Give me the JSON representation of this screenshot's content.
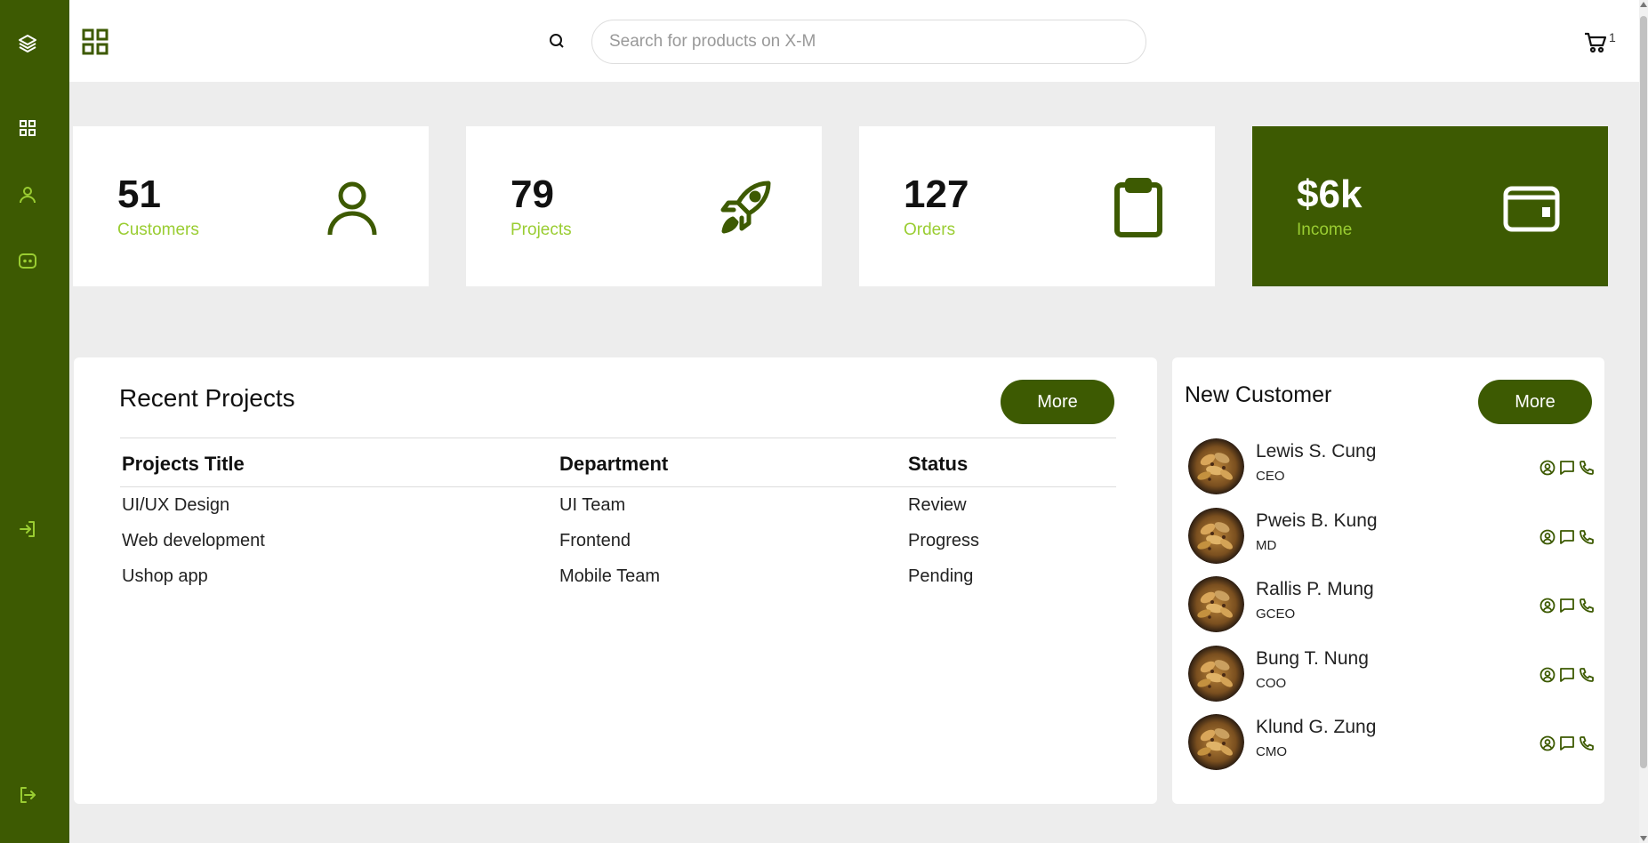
{
  "colors": {
    "brand": "#3d5a02",
    "accent": "#9acd32",
    "background": "#ededed"
  },
  "sidebar": {
    "items": [
      {
        "icon": "layers-icon"
      },
      {
        "icon": "dashboard-grid-icon"
      },
      {
        "icon": "user-icon"
      },
      {
        "icon": "chat-bot-icon"
      },
      {
        "icon": "login-icon"
      },
      {
        "icon": "logout-icon"
      }
    ]
  },
  "header": {
    "search_placeholder": "Search for products on X-M",
    "cart_count": "1"
  },
  "stats": [
    {
      "value": "51",
      "label": "Customers",
      "icon": "user-icon"
    },
    {
      "value": "79",
      "label": "Projects",
      "icon": "rocket-icon"
    },
    {
      "value": "127",
      "label": "Orders",
      "icon": "clipboard-icon"
    },
    {
      "value": "$6k",
      "label": "Income",
      "icon": "wallet-icon"
    }
  ],
  "recent_projects": {
    "title": "Recent Projects",
    "more_label": "More",
    "columns": [
      "Projects Title",
      "Department",
      "Status"
    ],
    "rows": [
      [
        "UI/UX Design",
        "UI Team",
        "Review"
      ],
      [
        "Web development",
        "Frontend",
        "Progress"
      ],
      [
        "Ushop app",
        "Mobile Team",
        "Pending"
      ]
    ]
  },
  "new_customer": {
    "title": "New Customer",
    "more_label": "More",
    "customers": [
      {
        "name": "Lewis S. Cung",
        "role": "CEO"
      },
      {
        "name": "Pweis B. Kung",
        "role": "MD"
      },
      {
        "name": "Rallis P. Mung",
        "role": "GCEO"
      },
      {
        "name": "Bung T. Nung",
        "role": "COO"
      },
      {
        "name": "Klund G. Zung",
        "role": "CMO"
      }
    ]
  }
}
